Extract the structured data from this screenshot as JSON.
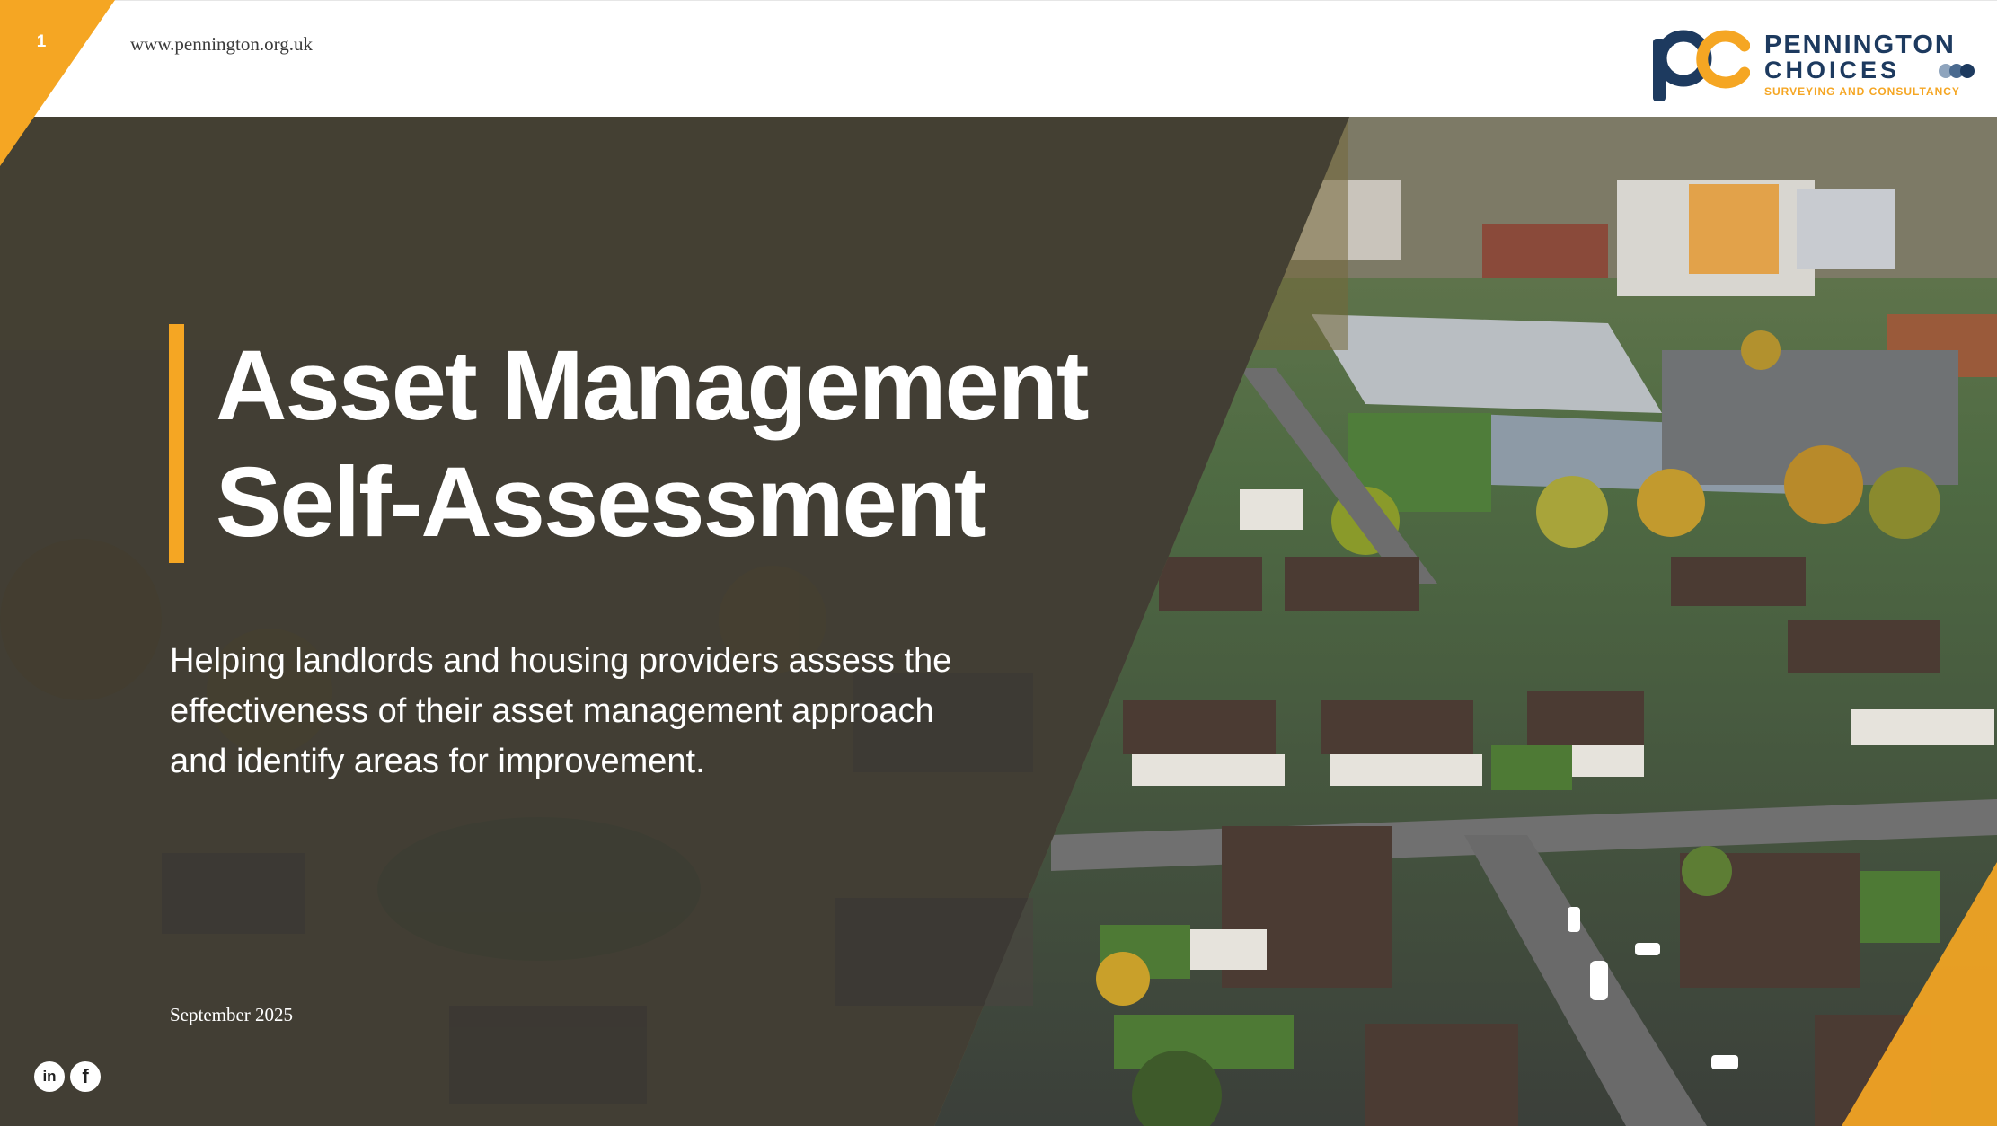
{
  "header": {
    "page_number": "1",
    "website": "www.pennington.org.uk"
  },
  "logo": {
    "name": "PENNINGTON",
    "sub": "CHOICES",
    "tagline": "SURVEYING AND CONSULTANCY"
  },
  "hero": {
    "title_line1": "Asset Management",
    "title_line2": "Self-Assessment",
    "subtitle": "Helping landlords and housing providers assess the effectiveness of their asset management approach and identify areas for improvement.",
    "date": "September 2025"
  },
  "social": {
    "linkedin_icon": "linkedin-icon",
    "facebook_icon": "facebook-icon"
  },
  "colors": {
    "accent": "#f5a623",
    "brand_navy": "#1d3a5f",
    "overlay": "#2f2f2f"
  }
}
